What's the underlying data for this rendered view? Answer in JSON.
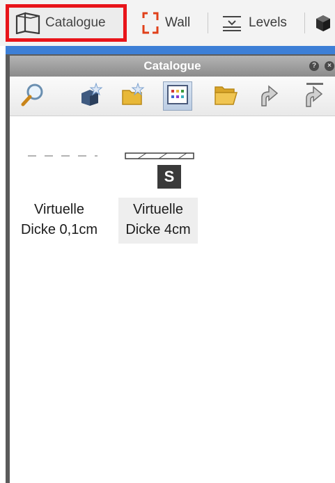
{
  "toolbar": {
    "catalogue_label": "Catalogue",
    "wall_label": "Wall",
    "levels_label": "Levels"
  },
  "panel": {
    "title": "Catalogue",
    "tools": [
      {
        "icon": "search-icon"
      },
      {
        "icon": "new-object-icon"
      },
      {
        "icon": "new-folder-icon"
      },
      {
        "icon": "grid-view-icon",
        "active": true
      },
      {
        "icon": "open-folder-icon"
      },
      {
        "icon": "up-arrow-icon"
      },
      {
        "icon": "up-top-icon"
      }
    ]
  },
  "items": [
    {
      "line1": "Virtuelle",
      "line2": "Dicke 0,1cm",
      "selected": false
    },
    {
      "line1": "Virtuelle",
      "line2": "Dicke 4cm",
      "selected": true,
      "badge": "S"
    }
  ],
  "colors": {
    "highlight": "#e8141a",
    "panel_accent": "#3d7fd6",
    "badge": "#3a3a3a"
  }
}
